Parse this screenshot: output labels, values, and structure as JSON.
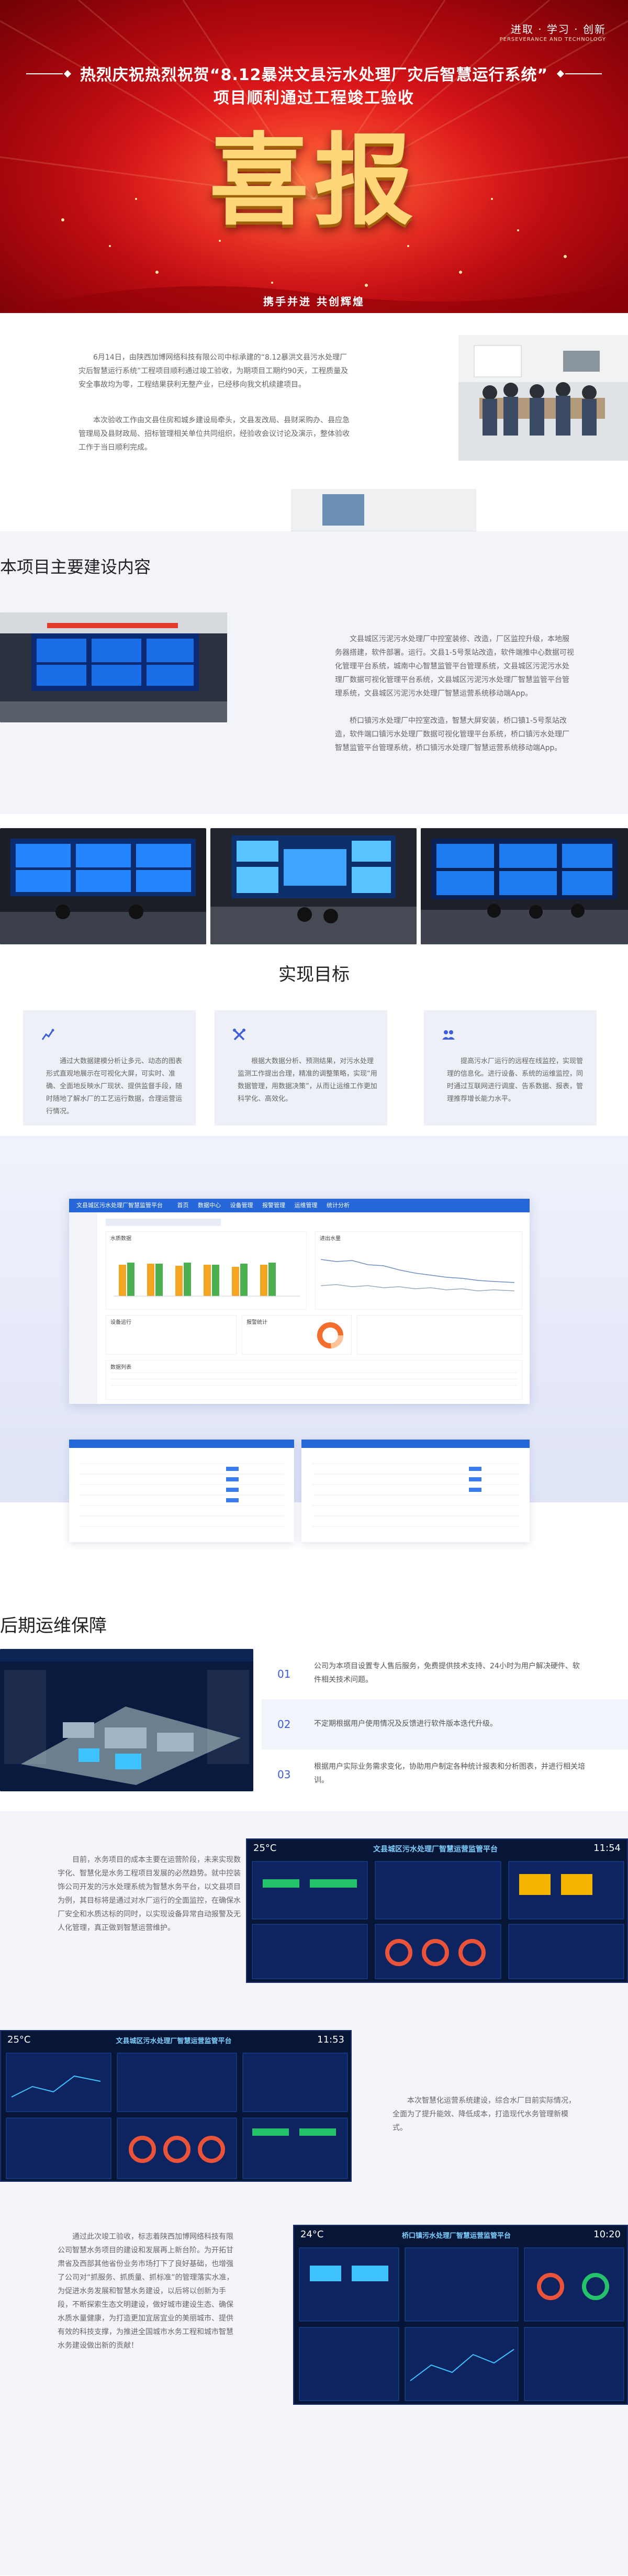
{
  "hero": {
    "motto": "进取 · 学习 · 创新",
    "motto_en": "PERSEVERANCE AND TECHNOLOGY",
    "title_line1": "热烈庆祝热烈祝贺“8.12暴洪文县污水处理厂灾后智慧运行系统”",
    "title_line2": "项目顺利通过工程竣工验收",
    "big_text": "喜报",
    "slogan": "携手并进 共创辉煌",
    "colors": {
      "red": "#d9141a",
      "gold": "#ffd77a"
    }
  },
  "intro": {
    "paragraph1": "6月14日，由陕西加博网络科技有限公司中标承建的“8.12暴洪文县污水处理厂灾后智慧运行系统”工程项目顺利通过竣工验收，为期项目工期约90天，工程质量及安全事故均为零，工程结果获利无整产业，已经移向我文机续建项目。",
    "paragraph2": "本次验收工作由文县住房和城乡建设局牵头，文县发改局、县财采购办、县应急管理局及县财政局、招标管理相关单位共同组织，经验收会议讨论及演示，整体验收工作于当日顺利完成。"
  },
  "section2": {
    "heading": "本项目主要建设内容",
    "paragraph1": "文县城区污泥污水处理厂中控室装修、改造，厂区监控升级，本地服务器搭建，软件部署。运行。文县1-5号泵站改造，软件端推中心数据可视化管理平台系统，城南中心智慧监管平台管理系统，文县城区污泥污水处理厂数据可视化管理平台系统，文县城区污泥污水处理厂智慧监管平台管理系统，文县城区污泥污水处理厂智慧运营系统移动端App。",
    "paragraph2": "桥口镇污水处理厂中控室改造，智慧大屏安装，桥口镇1-5号泵站改造，软件端口镇污水处理厂数据可视化管理平台系统，桥口镇污水处理厂智慧监管平台管理系统，桥口镇污水处理厂智慧运营系统移动端App。"
  },
  "goals": {
    "heading": "实现目标",
    "cards": [
      {
        "icon": "chart-icon",
        "text": "通过大数据建模分析让多元、动态的图表形式直观地展示在可视化大屏，可实时、准确、全面地反映水厂现状、提供监督手段，随时随地了解水厂的工艺运行数据，合理运营运行情况。"
      },
      {
        "icon": "tools-icon",
        "text": "根据大数据分析、预测结果，对污水处理监测工作提出合理，精准的调整策略，实现“用数据管理，用数据决策”，从而让运维工作更加科学化、高效化。"
      },
      {
        "icon": "users-icon",
        "text": "提高污水厂运行的远程在线监控，实现管理的信息化。进行设备、系统的运维监控，同时通过互联网进行调度、告系数据、报表，管理推荐增长能力水平。"
      }
    ]
  },
  "dashboard": {
    "header": "文县城区污水处理厂智慧监管平台",
    "tabs": [
      "首页",
      "数据中心",
      "设备管理",
      "报警管理",
      "运维管理",
      "统计分析"
    ],
    "panel1": "水质数据",
    "panel2": "进出水量",
    "panel3": "设备运行",
    "panel4": "报警统计",
    "panel5": "数据列表"
  },
  "maintenance": {
    "heading": "后期运维保障",
    "items": [
      {
        "num": "01",
        "text": "公司为本项目设置专人售后服务，免费提供技术支持、24小时为用户解决硬件、软件相关技术问题。"
      },
      {
        "num": "02",
        "text": "不定期根据用户使用情况及反馈进行软件版本迭代升级。"
      },
      {
        "num": "03",
        "text": "根据用户实际业务需求变化，协助用户制定各种统计报表和分析图表，并进行相关培训。"
      }
    ]
  },
  "lower": {
    "paragraph1": "目前，水务项目的成本主要在运营阶段，未来实现数字化、智慧化是水务工程项目发展的必然趋势。就中控装饰公司开发的污水处理系统为智慧水务平台，以文县项目为例，其目标将是通过对水厂运行的全面监控，在确保水厂安全和水质达标的同时，以实现设备异常自动报警及无人化管理，真正做到智慧运营维护。",
    "paragraph2": "本次智慧化运营系统建设，综合水厂目前实际情况，全面为了提升能效、降低成本，打造现代水务管理新模式。",
    "paragraph3": "通过此次竣工验收，标志着陕西加博网络科技有限公司智慧水务项目的建设和发展再上新台阶。为开拓甘肃省及西部其他省份业务市场打下了良好基础，也增强了公司对“抓服务、抓质量、抓标准”的管理落实水准，为促进水务发展和智慧水务建设，以后将以创新为手段，不断探索生态文明建设，做好城市建设生态、确保水质水量健康，为打造更加宜居宜业的美丽城市、提供有效的科技支撑，为推进全国城市水务工程和城市智慧水务建设做出新的贡献！",
    "panel1": {
      "temp": "25°C",
      "title": "文县城区污水处理厂智慧运营监管平台",
      "time": "11:54"
    },
    "panel2": {
      "temp": "25°C",
      "title": "文县城区污水处理厂智慧运营监管平台",
      "time": "11:53"
    },
    "panel3": {
      "temp": "24°C",
      "title": "桥口镇污水处理厂智慧运营监管平台",
      "time": "10:20"
    }
  }
}
